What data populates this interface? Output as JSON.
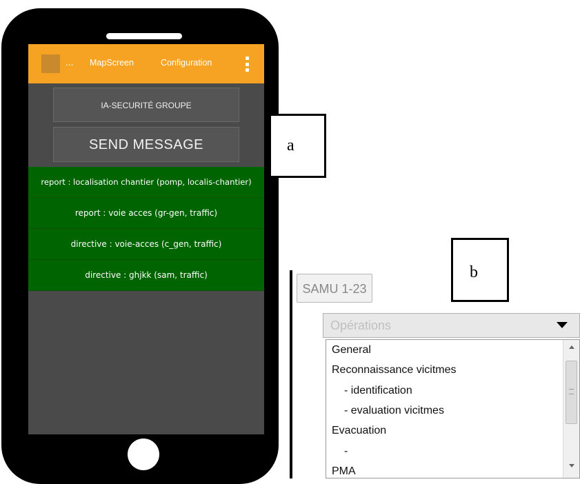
{
  "phone": {
    "appbar": {
      "overflow_text": "...",
      "tabs": [
        "MapScreen",
        "Configuration"
      ],
      "menu_icon": "more-vert-icon",
      "color": "#f6a323"
    },
    "buttons": {
      "group_label": "IA-SECURITÉ GROUPE",
      "send_label": "SEND MESSAGE"
    },
    "messages": [
      "report : localisation chantier  (pomp, localis-chantier)",
      "report : voie  acces (gr-gen, traffic)",
      "directive : voie-acces (c_gen, traffic)",
      "directive : ghjkk (sam, traffic)"
    ],
    "message_color": "#006400"
  },
  "callouts": {
    "a": "a",
    "b": "b"
  },
  "panel_b": {
    "unit_button": "SAMU 1-23",
    "select_value": "Opérations",
    "options": [
      "General",
      "Reconnaissance vicitmes",
      "- identification",
      "- evaluation vicitmes",
      "Evacuation",
      "-",
      "PMA"
    ]
  }
}
